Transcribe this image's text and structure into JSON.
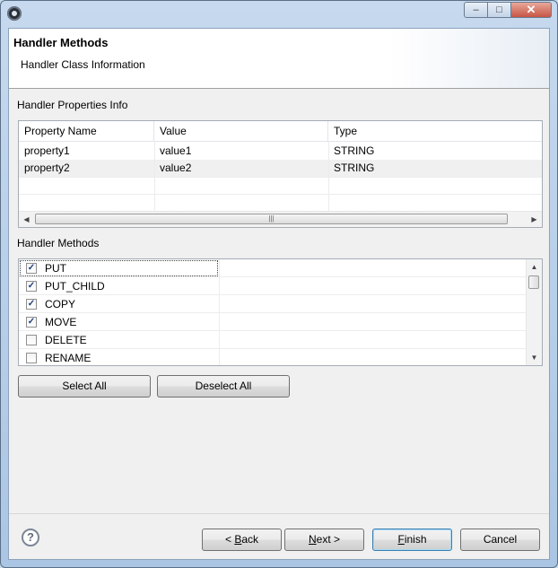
{
  "window": {
    "minimize_glyph": "–",
    "maximize_glyph": "□",
    "close_glyph": "✕"
  },
  "header": {
    "title": "Handler Methods",
    "subtitle": "Handler Class Information"
  },
  "properties": {
    "section_label": "Handler Properties Info",
    "columns": [
      "Property Name",
      "Value",
      "Type"
    ],
    "rows": [
      [
        "property1",
        "value1",
        "STRING"
      ],
      [
        "property2",
        "value2",
        "STRING"
      ]
    ],
    "scroll_left": "◀",
    "scroll_right": "▶",
    "thumb_grip": "|||"
  },
  "methods": {
    "section_label": "Handler Methods",
    "items": [
      {
        "label": "PUT",
        "checked": true
      },
      {
        "label": "PUT_CHILD",
        "checked": true
      },
      {
        "label": "COPY",
        "checked": true
      },
      {
        "label": "MOVE",
        "checked": true
      },
      {
        "label": "DELETE",
        "checked": false
      },
      {
        "label": "RENAME",
        "checked": false
      }
    ],
    "scroll_up": "▲",
    "scroll_down": "▼",
    "check_glyph": "✓"
  },
  "buttons": {
    "select_all": "Select All",
    "deselect_all": "Deselect All",
    "back_mnemonic": "B",
    "back_prefix": "< ",
    "back_rest": "ack",
    "next_mnemonic": "N",
    "next_rest": "ext >",
    "finish_mnemonic": "F",
    "finish_rest": "inish",
    "cancel": "Cancel"
  },
  "help": {
    "glyph": "?"
  }
}
